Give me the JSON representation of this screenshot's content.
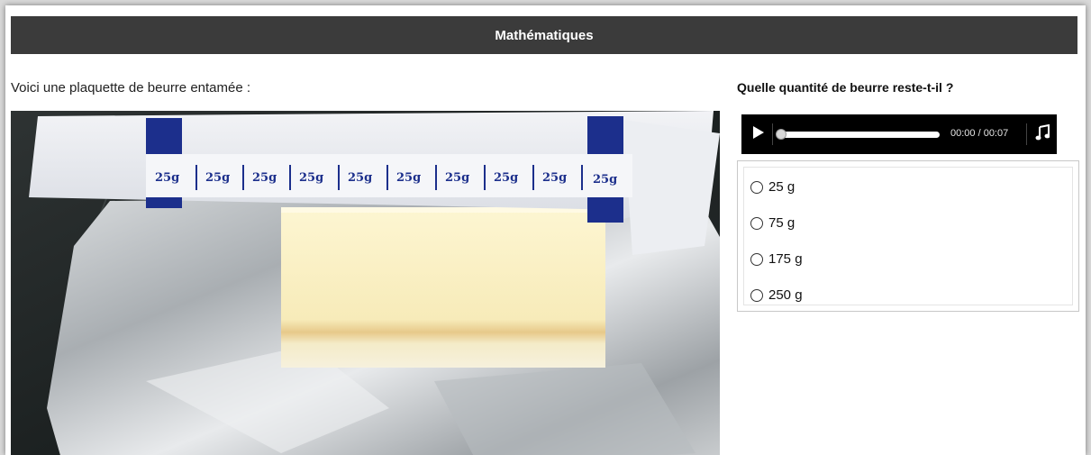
{
  "header": {
    "title": "Mathématiques"
  },
  "left": {
    "intro": "Voici une plaquette de beurre entamée :"
  },
  "photo": {
    "wrapper_labels": [
      "25g",
      "25g",
      "25g",
      "25g",
      "25g",
      "25g",
      "25g",
      "25g",
      "25g",
      "25g"
    ],
    "wrapper_blue": "#1c2f8c"
  },
  "right": {
    "question": "Quelle quantité de beurre reste-t-il ?",
    "audio": {
      "time": "00:00 / 00:07",
      "progress": 0
    },
    "options": [
      {
        "label": "25 g"
      },
      {
        "label": "75 g"
      },
      {
        "label": "175 g"
      },
      {
        "label": "250 g"
      }
    ]
  }
}
